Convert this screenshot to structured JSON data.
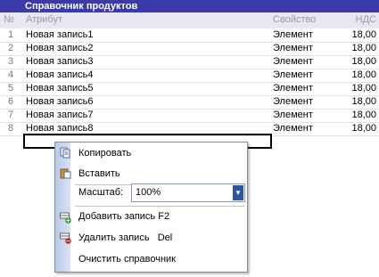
{
  "title": "Справочник продуктов",
  "columns": {
    "num": "№",
    "name": "Атрибут",
    "prop": "Свойство",
    "vat": "НДС"
  },
  "rows": [
    {
      "num": "1",
      "name": "Новая запись1",
      "prop": "Элемент",
      "vat": "18,00"
    },
    {
      "num": "2",
      "name": "Новая запись2",
      "prop": "Элемент",
      "vat": "18,00"
    },
    {
      "num": "3",
      "name": "Новая запись3",
      "prop": "Элемент",
      "vat": "18,00"
    },
    {
      "num": "4",
      "name": "Новая запись4",
      "prop": "Элемент",
      "vat": "18,00"
    },
    {
      "num": "5",
      "name": "Новая запись5",
      "prop": "Элемент",
      "vat": "18,00"
    },
    {
      "num": "6",
      "name": "Новая запись6",
      "prop": "Элемент",
      "vat": "18,00"
    },
    {
      "num": "7",
      "name": "Новая запись7",
      "prop": "Элемент",
      "vat": "18,00"
    },
    {
      "num": "8",
      "name": "Новая запись8",
      "prop": "Элемент",
      "vat": "18,00"
    }
  ],
  "menu": {
    "copy": "Копировать",
    "paste": "Вставить",
    "zoom_label": "Масштаб:",
    "zoom_value": "100%",
    "add": "Добавить запись F2",
    "delete": "Удалить запись   Del",
    "clear": "Очистить справочник"
  },
  "colors": {
    "title_bg": "#3a3aa8",
    "header_bg": "#e7e7f3",
    "menu_strip": "#c8d6f0"
  }
}
